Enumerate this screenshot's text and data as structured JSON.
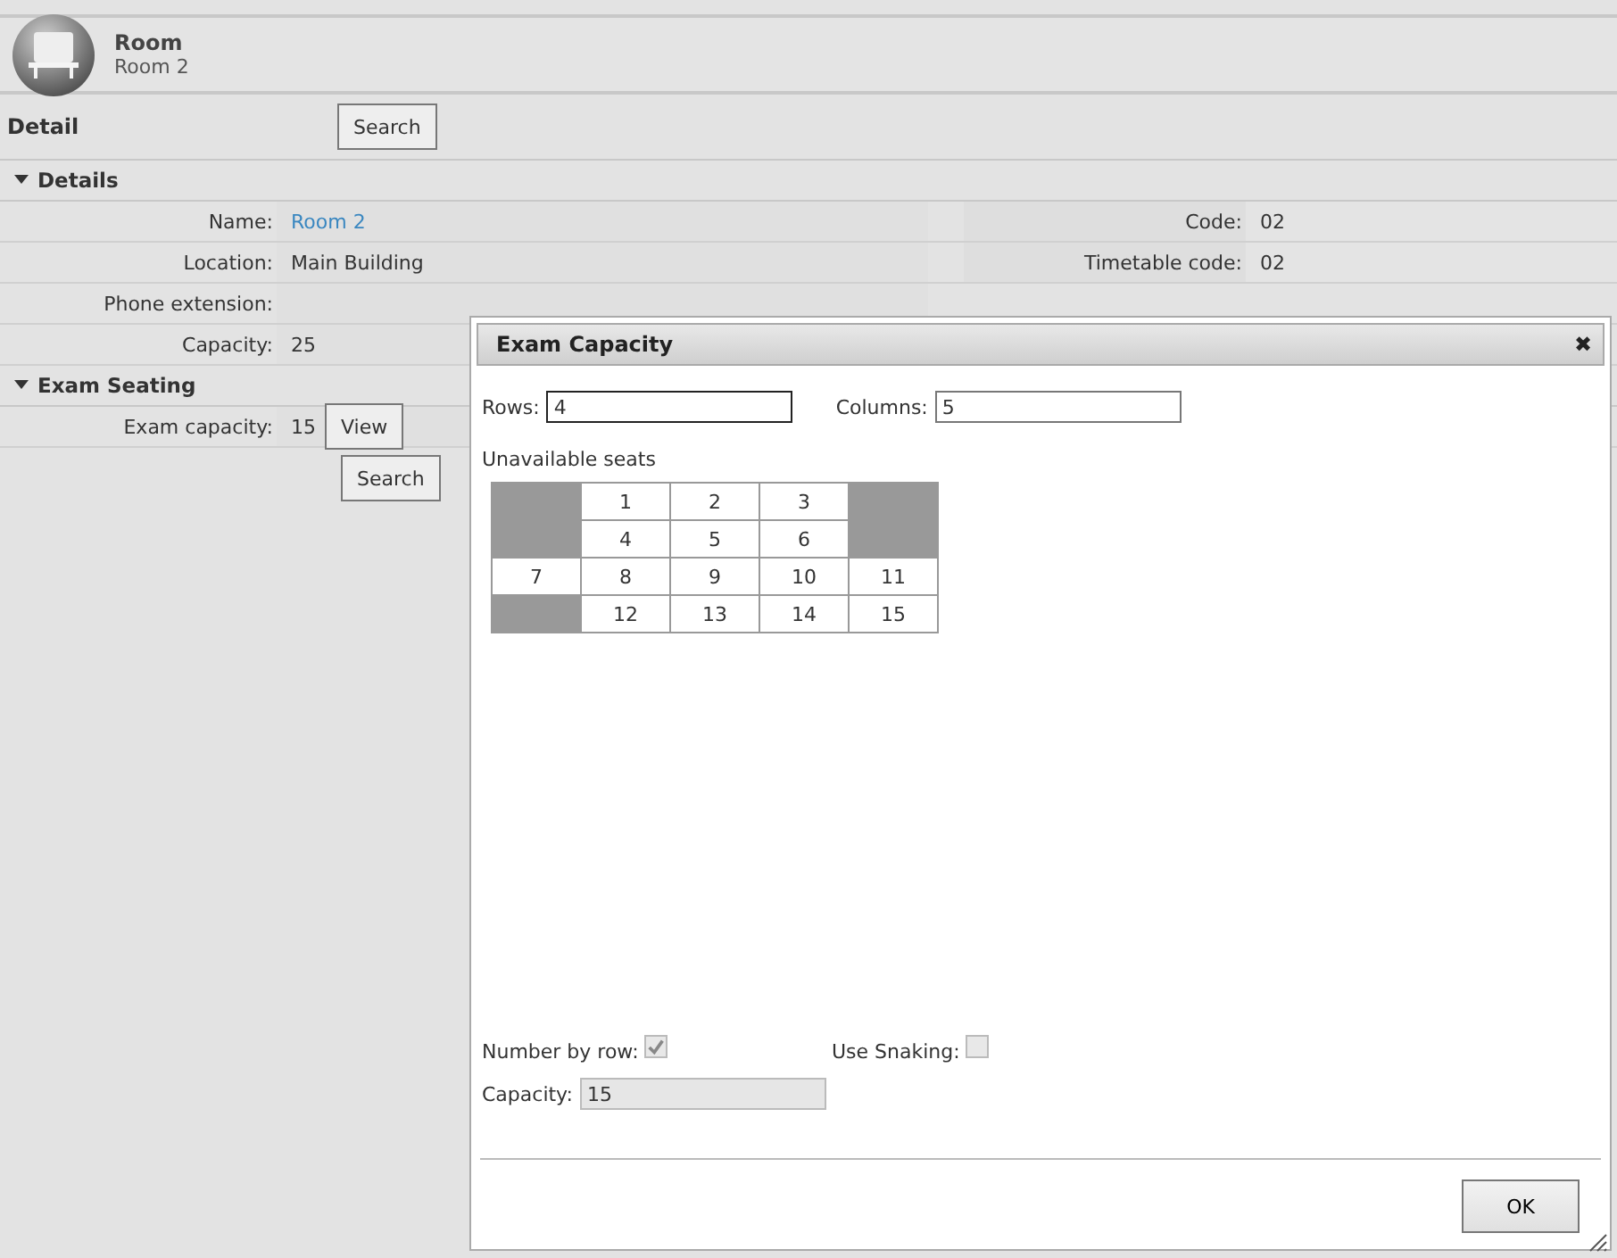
{
  "header": {
    "title": "Room",
    "subtitle": "Room 2"
  },
  "toolbar": {
    "title": "Detail",
    "button": "Search"
  },
  "sections": [
    {
      "title": "Details",
      "expanded": true,
      "rows": [
        {
          "label": "Name:",
          "value": "Room 2",
          "kind": "link",
          "right_label": "Code:",
          "right_value": "02"
        },
        {
          "label": "Location:",
          "value": "Main Building",
          "kind": "text",
          "right_label": "Timetable code:",
          "right_value": "02"
        },
        {
          "label": "Phone extension:",
          "kind": "text"
        },
        {
          "label": "Capacity:",
          "value": "25",
          "kind": "text"
        }
      ]
    },
    {
      "title": "Exam Seating",
      "expanded": true,
      "rows": [
        {
          "label": "Exam capacity:",
          "value": "15",
          "kind": "button",
          "button": "View"
        }
      ]
    }
  ],
  "bottom_button": "Search",
  "dialog": {
    "title": "Exam Capacity",
    "close": "✖",
    "rows_label": "Rows:",
    "rows_value": "4",
    "columns_label": "Columns:",
    "columns_value": "5",
    "seats_label": "Unavailable seats",
    "seats": [
      [
        {
          "unavailable": true
        },
        {
          "number": "1",
          "unavailable": false
        },
        {
          "number": "2",
          "unavailable": false
        },
        {
          "number": "3",
          "unavailable": false
        },
        {
          "unavailable": true
        }
      ],
      [
        {
          "unavailable": true
        },
        {
          "number": "4",
          "unavailable": false
        },
        {
          "number": "5",
          "unavailable": false
        },
        {
          "number": "6",
          "unavailable": false
        },
        {
          "unavailable": true
        }
      ],
      [
        {
          "number": "7",
          "unavailable": false
        },
        {
          "number": "8",
          "unavailable": false
        },
        {
          "number": "9",
          "unavailable": false
        },
        {
          "number": "10",
          "unavailable": false
        },
        {
          "number": "11",
          "unavailable": false
        }
      ],
      [
        {
          "unavailable": true
        },
        {
          "number": "12",
          "unavailable": false
        },
        {
          "number": "13",
          "unavailable": false
        },
        {
          "number": "14",
          "unavailable": false
        },
        {
          "number": "15",
          "unavailable": false
        }
      ]
    ],
    "number_by_row": {
      "label": "Number by row:",
      "checked": true
    },
    "use_snaking": {
      "label": "Use Snaking:",
      "checked": false
    },
    "capacity_label": "Capacity:",
    "capacity_value": "15",
    "ok": "OK"
  }
}
